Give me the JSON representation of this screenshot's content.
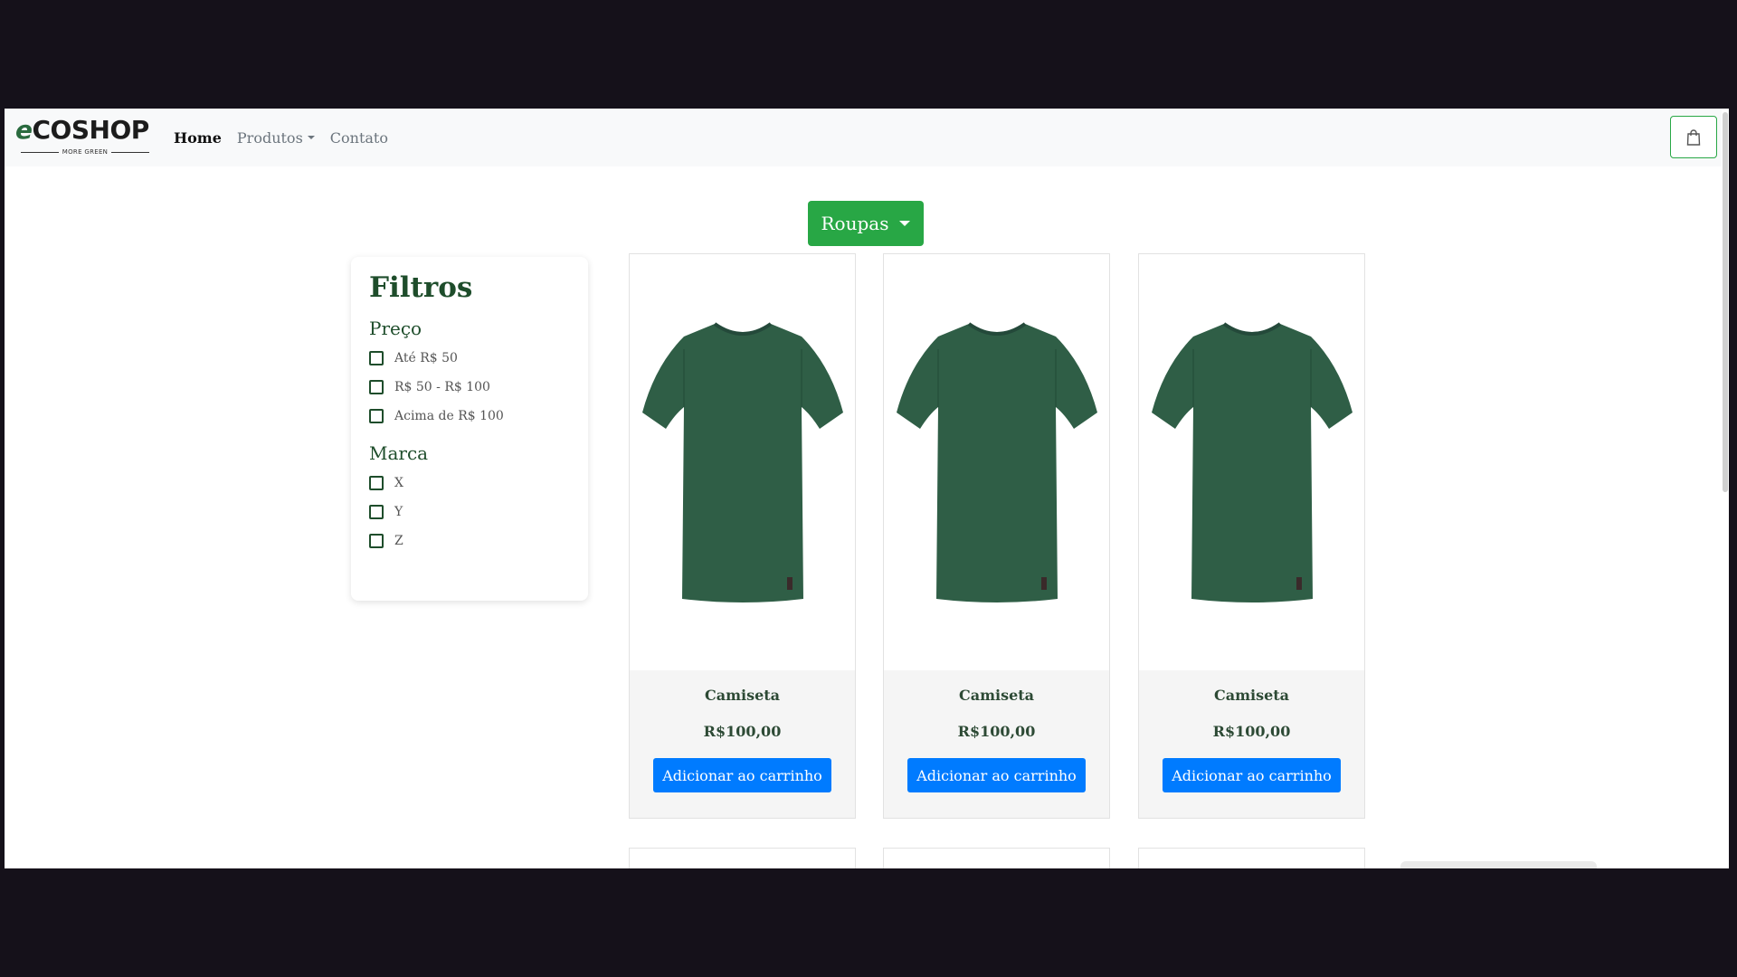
{
  "navbar": {
    "logo_main": "COSHOP",
    "logo_e": "e",
    "logo_tagline": "MORE GREEN",
    "links": [
      {
        "label": "Home"
      },
      {
        "label": "Produtos"
      },
      {
        "label": "Contato"
      }
    ],
    "cart_icon": "shopping-bag-icon"
  },
  "category": {
    "label": "Roupas"
  },
  "filters": {
    "title": "Filtros",
    "price_heading": "Preço",
    "price_options": [
      "Até R$ 50",
      "R$ 50 - R$ 100",
      "Acima de R$ 100"
    ],
    "brand_heading": "Marca",
    "brand_options": [
      "X",
      "Y",
      "Z"
    ]
  },
  "products": [
    {
      "name": "Camiseta",
      "price": "R$100,00",
      "button": "Adicionar ao carrinho"
    },
    {
      "name": "Camiseta",
      "price": "R$100,00",
      "button": "Adicionar ao carrinho"
    },
    {
      "name": "Camiseta",
      "price": "R$100,00",
      "button": "Adicionar ao carrinho"
    }
  ],
  "colors": {
    "brand_green": "#28a745",
    "dark_green": "#1e4d2b",
    "shirt_green": "#2f5e46",
    "primary_blue": "#007bff"
  }
}
